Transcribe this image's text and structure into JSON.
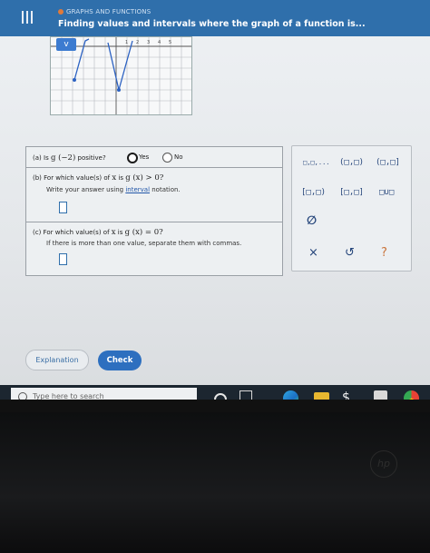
{
  "header": {
    "topic": "GRAPHS AND FUNCTIONS",
    "title": "Finding values and intervals where the graph of a function is..."
  },
  "graph": {
    "x_ticks": [
      "1",
      "2",
      "3",
      "4",
      "5"
    ],
    "expand_label": "v"
  },
  "questions": {
    "a": {
      "prefix": "(a)",
      "text_is": "Is",
      "expr": "g (−2)",
      "text_after": "positive?",
      "opt_yes": "Yes",
      "opt_no": "No",
      "selected": "Yes"
    },
    "b": {
      "prefix": "(b)",
      "text1": "For which value(s) of",
      "var": "x",
      "text2": "is",
      "expr": "g (x) > 0?",
      "instr_pre": "Write your answer using",
      "instr_link": "interval",
      "instr_post": "notation."
    },
    "c": {
      "prefix": "(c)",
      "text1": "For which value(s) of",
      "var": "x",
      "text2": "is",
      "expr": "g (x) = 0?",
      "instr": "If there is more than one value, separate them with commas."
    }
  },
  "palette": {
    "row1": [
      "□,□,...",
      "(□,□)",
      "(□,□]"
    ],
    "row2": [
      "[□,□)",
      "[□,□]",
      "□∪□"
    ],
    "empty_set": "∅",
    "clear": "×",
    "undo": "↺",
    "help": "?"
  },
  "buttons": {
    "explanation": "Explanation",
    "check": "Check"
  },
  "taskbar": {
    "search_placeholder": "Type here to search"
  }
}
